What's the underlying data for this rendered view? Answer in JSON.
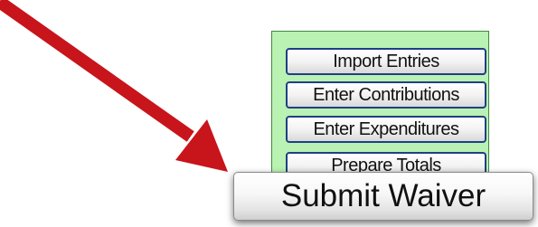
{
  "menu": {
    "items": [
      {
        "label": "Import Entries"
      },
      {
        "label": "Enter Contributions"
      },
      {
        "label": "Enter Expenditures"
      },
      {
        "label": "Prepare Totals"
      }
    ]
  },
  "submit": {
    "label": "Submit Waiver"
  },
  "colors": {
    "panel_background": "#b9f2b3",
    "button_border": "#1f3f86",
    "arrow": "#c8141b"
  },
  "annotation": {
    "icon": "red-arrow-icon"
  }
}
